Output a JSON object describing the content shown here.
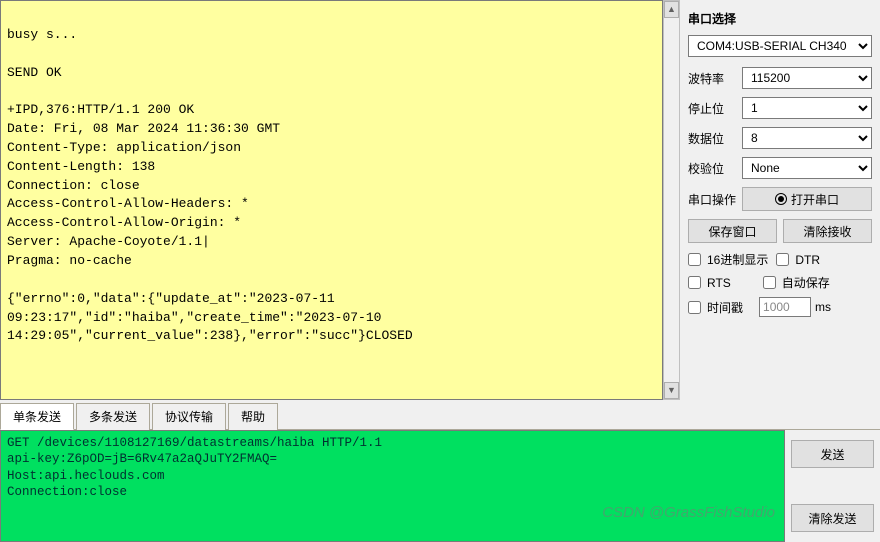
{
  "receive_text": "\nbusy s...\n\nSEND OK\n\n+IPD,376:HTTP/1.1 200 OK\nDate: Fri, 08 Mar 2024 11:36:30 GMT\nContent-Type: application/json\nContent-Length: 138\nConnection: close\nAccess-Control-Allow-Headers: *\nAccess-Control-Allow-Origin: *\nServer: Apache-Coyote/1.1|\nPragma: no-cache\n\n{\"errno\":0,\"data\":{\"update_at\":\"2023-07-11 09:23:17\",\"id\":\"haiba\",\"create_time\":\"2023-07-10 14:29:05\",\"current_value\":238},\"error\":\"succ\"}CLOSED",
  "right": {
    "port_section_title": "串口选择",
    "port_value": "COM4:USB-SERIAL CH340",
    "baud_label": "波特率",
    "baud_value": "115200",
    "stop_label": "停止位",
    "stop_value": "1",
    "data_label": "数据位",
    "data_value": "8",
    "parity_label": "校验位",
    "parity_value": "None",
    "op_label": "串口操作",
    "open_btn": "打开串口",
    "save_window_btn": "保存窗口",
    "clear_recv_btn": "清除接收",
    "hex_display": "16进制显示",
    "dtr": "DTR",
    "rts": "RTS",
    "auto_save": "自动保存",
    "timestamp": "时间戳",
    "interval_value": "1000",
    "interval_unit": "ms"
  },
  "tabs": {
    "single": "单条发送",
    "multi": "多条发送",
    "protocol": "协议传输",
    "help": "帮助"
  },
  "send_text": "GET /devices/1108127169/datastreams/haiba HTTP/1.1\napi-key:Z6pOD=jB=6Rv47a2aQJuTY2FMAQ=\nHost:api.heclouds.com\nConnection:close",
  "send_btn": "发送",
  "clear_send_btn": "清除发送",
  "watermark": "CSDN @GrassFishStudio"
}
